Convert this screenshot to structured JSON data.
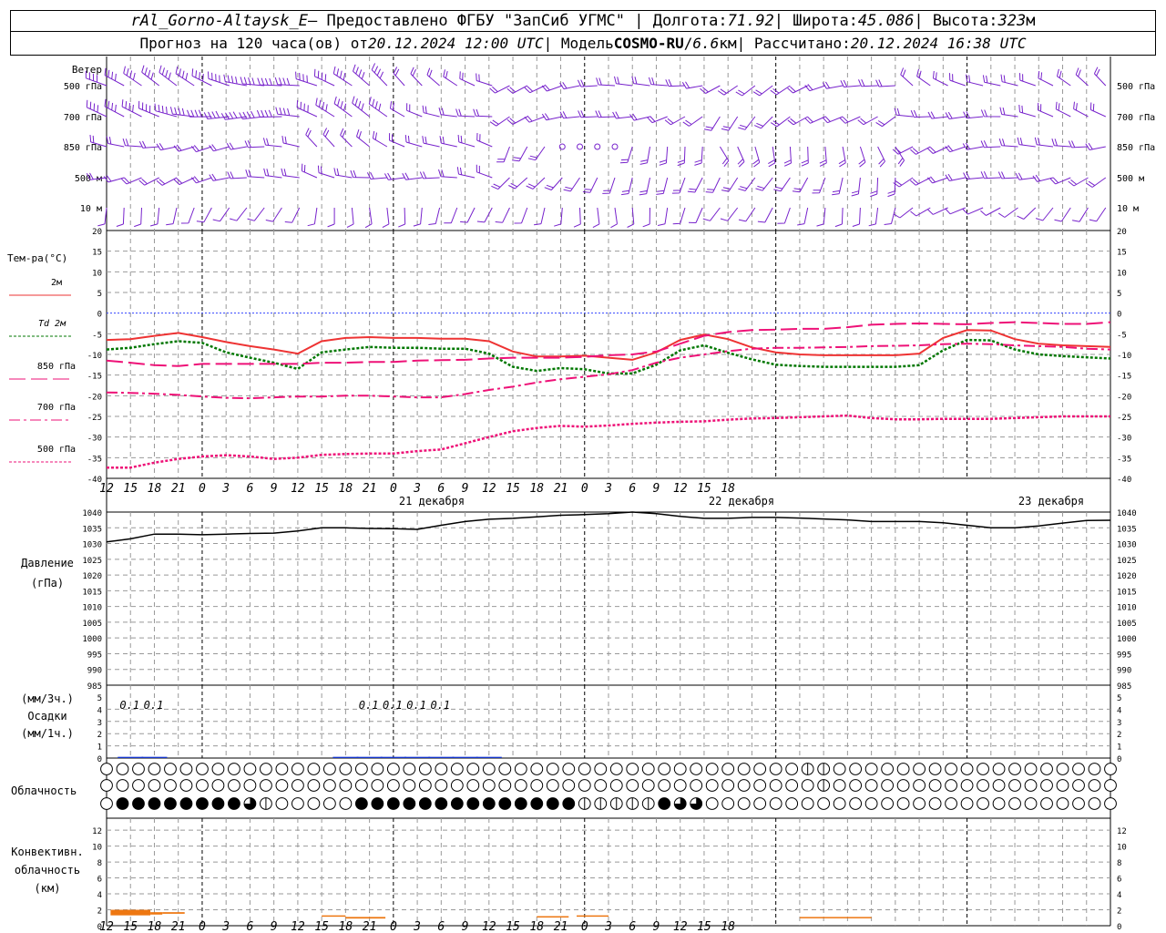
{
  "header": {
    "station": "rAl_Gorno-Altaysk_E",
    "provider_prefix": " – Предоставлено ФГБУ \"ЗапСиб УГМС\" | Долгота: ",
    "lon": "71.92",
    "lat_label": " | Широта: ",
    "lat": "45.086",
    "alt_label": " | Высота: ",
    "alt": "323",
    "alt_unit": "м",
    "forecast_prefix": "Прогноз на 120 часа(ов) от ",
    "run_time": "20.12.2024 12:00 UTC",
    "model_label": " | Модель ",
    "model": "COSMO-RU",
    "slash": " / ",
    "resolution": "6.6",
    "res_unit": "км",
    "calc_label": " | Рассчитано: ",
    "calc_time": "20.12.2024 16:38 UTC"
  },
  "wind_panel": {
    "title": "Ветер",
    "levels": [
      "500 гПа",
      "700 гПа",
      "850 гПа",
      "500 м",
      "10  м"
    ]
  },
  "temp_panel": {
    "title": "Тем-ра(°C)",
    "legend": [
      {
        "label": "2м",
        "color": "#ee3333",
        "dash": ""
      },
      {
        "label": "Td  2м",
        "color": "#007700",
        "dash": "3,2"
      },
      {
        "label": "850 гПа",
        "color": "#ee1177",
        "dash": "18,6"
      },
      {
        "label": "700 гПа",
        "color": "#ee1177",
        "dash": "12,4,3,4"
      },
      {
        "label": "500 гПа",
        "color": "#ee1177",
        "dash": "3,2"
      }
    ],
    "y_ticks": [
      "20",
      "15",
      "10",
      "5",
      "0",
      "-5",
      "-10",
      "-15",
      "-20",
      "-25",
      "-30",
      "-35",
      "-40"
    ]
  },
  "time_axis": {
    "hour_labels": [
      "12",
      "15",
      "18",
      "21",
      "0",
      "3",
      "6",
      "9",
      "12",
      "15",
      "18",
      "21",
      "0",
      "3",
      "6",
      "9",
      "12",
      "15",
      "18",
      "21",
      "0",
      "3",
      "6",
      "9",
      "12",
      "15",
      "18"
    ],
    "days": [
      "21 декабря",
      "22 декабря",
      "23 декабря"
    ]
  },
  "pressure_panel": {
    "title": "Давление",
    "unit": "(гПа)",
    "y_ticks": [
      "1040",
      "1035",
      "1030",
      "1025",
      "1020",
      "1015",
      "1010",
      "1005",
      "1000",
      "995",
      "990",
      "985"
    ]
  },
  "precip_panel": {
    "unit_3h": "(мм/3ч.)",
    "title": "Осадки",
    "unit_1h": "(мм/1ч.)",
    "y_ticks": [
      "5",
      "4",
      "3",
      "2",
      "1",
      "0"
    ],
    "labels": [
      "0.1",
      "0.1",
      "0.1",
      "0.1",
      "0.1",
      "0.1"
    ]
  },
  "cloud_panel": {
    "title": "Облачность"
  },
  "conv_panel": {
    "title_1": "Конвективн.",
    "title_2": "облачность",
    "unit": "(км)",
    "y_ticks": [
      "12",
      "10",
      "8",
      "6",
      "4",
      "2",
      "0"
    ]
  },
  "chart_data": [
    {
      "type": "line",
      "panel": "temperature",
      "ylabel": "Тем-ра(°C)",
      "ylim": [
        -40,
        20
      ],
      "x_hours": [
        0,
        3,
        6,
        9,
        12,
        15,
        18,
        21,
        24,
        27,
        30,
        33,
        36,
        39,
        42,
        45,
        48,
        51,
        54,
        57,
        60,
        63,
        66,
        69,
        72,
        75,
        78,
        81,
        84,
        87,
        90,
        93,
        96,
        99,
        102,
        105,
        108,
        111,
        114,
        117,
        120,
        123,
        126
      ],
      "series": [
        {
          "name": "2м",
          "values": [
            -6.5,
            -6.3,
            -5.5,
            -4.8,
            -5.8,
            -7,
            -8,
            -8.8,
            -9.8,
            -6.8,
            -6,
            -5.8,
            -6,
            -6,
            -6.2,
            -6.2,
            -6.8,
            -9.3,
            -10.5,
            -10.5,
            -10.3,
            -10.8,
            -11.3,
            -9.5,
            -6.5,
            -5.2,
            -6.3,
            -8.3,
            -9.5,
            -10,
            -10.2,
            -10.2,
            -10.2,
            -10.2,
            -9.8,
            -6,
            -4.1,
            -4.2,
            -6.3,
            -7.4,
            -7.8,
            -8,
            -8.2
          ]
        },
        {
          "name": "Td  2м",
          "values": [
            -8.8,
            -8.4,
            -7.5,
            -6.8,
            -7.2,
            -9.5,
            -10.8,
            -12,
            -13.5,
            -9.5,
            -8.8,
            -8.2,
            -8.4,
            -8.4,
            -8.6,
            -8.6,
            -9.8,
            -13,
            -14,
            -13.3,
            -13.6,
            -14.6,
            -14.6,
            -12.5,
            -9,
            -7.8,
            -9.6,
            -11.2,
            -12.5,
            -12.8,
            -13,
            -13,
            -13,
            -13,
            -12.6,
            -9,
            -6.5,
            -6.6,
            -8.8,
            -10,
            -10.4,
            -10.7,
            -11
          ]
        },
        {
          "name": "850 гПа",
          "values": [
            -11.5,
            -12,
            -12.6,
            -12.8,
            -12.3,
            -12.3,
            -12.3,
            -12.3,
            -12.3,
            -12,
            -12,
            -11.8,
            -11.8,
            -11.5,
            -11.4,
            -11.3,
            -11,
            -10.8,
            -10.8,
            -10.8,
            -10.6,
            -10.2,
            -10,
            -9.3,
            -7.4,
            -5.5,
            -4.6,
            -4.1,
            -4,
            -3.8,
            -3.8,
            -3.4,
            -2.8,
            -2.6,
            -2.5,
            -2.6,
            -2.7,
            -2.4,
            -2.2,
            -2.4,
            -2.6,
            -2.6,
            -2.2
          ]
        },
        {
          "name": "700 гПа",
          "values": [
            -19.2,
            -19.3,
            -19.5,
            -19.8,
            -20.2,
            -20.5,
            -20.6,
            -20.4,
            -20.2,
            -20.2,
            -20,
            -20,
            -20.2,
            -20.4,
            -20.4,
            -19.6,
            -18.6,
            -17.8,
            -16.8,
            -16,
            -15.4,
            -14.8,
            -13.8,
            -12,
            -10.8,
            -10,
            -9.2,
            -8.6,
            -8.4,
            -8.4,
            -8.3,
            -8.2,
            -8,
            -7.9,
            -7.8,
            -7.5,
            -7.4,
            -7.5,
            -7.8,
            -8,
            -8.2,
            -8.6,
            -8.8
          ]
        },
        {
          "name": "500 гПа",
          "values": [
            -37.4,
            -37.4,
            -36.2,
            -35.3,
            -34.7,
            -34.4,
            -34.7,
            -35.3,
            -35,
            -34.3,
            -34.1,
            -34,
            -34,
            -33.4,
            -33,
            -31.5,
            -30,
            -28.6,
            -27.8,
            -27.3,
            -27.5,
            -27.2,
            -26.8,
            -26.5,
            -26.3,
            -26.2,
            -25.8,
            -25.5,
            -25.4,
            -25.2,
            -25,
            -24.8,
            -25.4,
            -25.7,
            -25.7,
            -25.6,
            -25.6,
            -25.6,
            -25.4,
            -25.2,
            -25,
            -25,
            -25
          ]
        }
      ]
    },
    {
      "type": "line",
      "panel": "pressure",
      "ylabel": "Давление (гПа)",
      "ylim": [
        985,
        1040
      ],
      "x_hours": [
        0,
        3,
        6,
        9,
        12,
        15,
        18,
        21,
        24,
        27,
        30,
        33,
        36,
        39,
        42,
        45,
        48,
        51,
        54,
        57,
        60,
        63,
        66,
        69,
        72,
        75,
        78,
        81,
        84,
        87,
        90,
        93,
        96,
        99,
        102,
        105,
        108,
        111,
        114,
        117,
        120,
        123,
        126
      ],
      "series": [
        {
          "name": "Давление",
          "values": [
            1030.5,
            1031.5,
            1033,
            1033,
            1032.8,
            1033,
            1033.2,
            1033.3,
            1034,
            1035,
            1035,
            1034.8,
            1034.7,
            1034.5,
            1035.8,
            1037,
            1037.7,
            1038,
            1038.5,
            1039,
            1039.2,
            1039.5,
            1040,
            1039.5,
            1038.6,
            1038,
            1038,
            1038.3,
            1038.3,
            1038.1,
            1037.8,
            1037.5,
            1037,
            1037,
            1037,
            1036.6,
            1035.8,
            1035,
            1035,
            1035.6,
            1036.5,
            1037.3,
            1037.4
          ]
        }
      ]
    },
    {
      "type": "bar",
      "panel": "precipitation",
      "ylabel": "Осадки (мм/3ч., мм/1ч.)",
      "ylim": [
        0,
        5
      ],
      "x_hours": [
        3,
        6,
        30,
        33,
        36,
        39,
        42,
        45,
        48
      ],
      "values": [
        0.1,
        0.1,
        0.1,
        0.1,
        0.1,
        0.1,
        0.1,
        0.1,
        0.1
      ],
      "label_positions_hours": [
        3,
        6,
        33,
        36,
        39,
        42
      ],
      "labels": [
        "0.1",
        "0.1",
        "0.1",
        "0.1",
        "0.1",
        "0.1"
      ]
    },
    {
      "type": "table",
      "panel": "cloudiness",
      "note": "fraction filled per hourly circle; rows high, middle, low",
      "layer_names": [
        "high",
        "middle",
        "low"
      ],
      "high_half_hours": [
        88,
        90
      ],
      "middle_half_hours": [
        90,
        103
      ],
      "low": [
        {
          "from": 1,
          "to": 8,
          "value": 1
        },
        {
          "from": 9,
          "to": 9,
          "value": 0.75
        },
        {
          "from": 10,
          "to": 10,
          "value": 0.5
        },
        {
          "from": 16,
          "to": 29,
          "value": 1
        },
        {
          "from": 30,
          "to": 34,
          "value": 0.5
        },
        {
          "from": 35,
          "to": 35,
          "value": 1
        },
        {
          "from": 36,
          "to": 37,
          "value": 0.75
        }
      ]
    },
    {
      "type": "bar",
      "panel": "convective_cloud",
      "ylabel": "Конвективн. облачность (км)",
      "ylim": [
        0,
        13
      ],
      "segments": [
        {
          "x0": 0.5,
          "x1": 5.5,
          "base": 1.3,
          "top": 2.0
        },
        {
          "x0": 5.5,
          "x1": 7,
          "base": 1.4,
          "top": 1.7
        },
        {
          "x0": 7,
          "x1": 9.8,
          "base": 1.5,
          "top": 1.7
        },
        {
          "x0": 27,
          "x1": 30,
          "base": 1.2,
          "top": 1.3
        },
        {
          "x0": 30,
          "x1": 35,
          "base": 0.9,
          "top": 1.1
        },
        {
          "x0": 54,
          "x1": 58,
          "base": 1.1,
          "top": 1.2
        },
        {
          "x0": 59,
          "x1": 63,
          "base": 1.2,
          "top": 1.3
        },
        {
          "x0": 87,
          "x1": 96,
          "base": 1.0,
          "top": 1.1
        }
      ]
    }
  ],
  "colors": {
    "grid": "#999999",
    "zero_line": "#3344ff",
    "pressure": "#000000",
    "precip": "#1133cc",
    "convective": "#ee7711",
    "wind": "#7722cc"
  }
}
